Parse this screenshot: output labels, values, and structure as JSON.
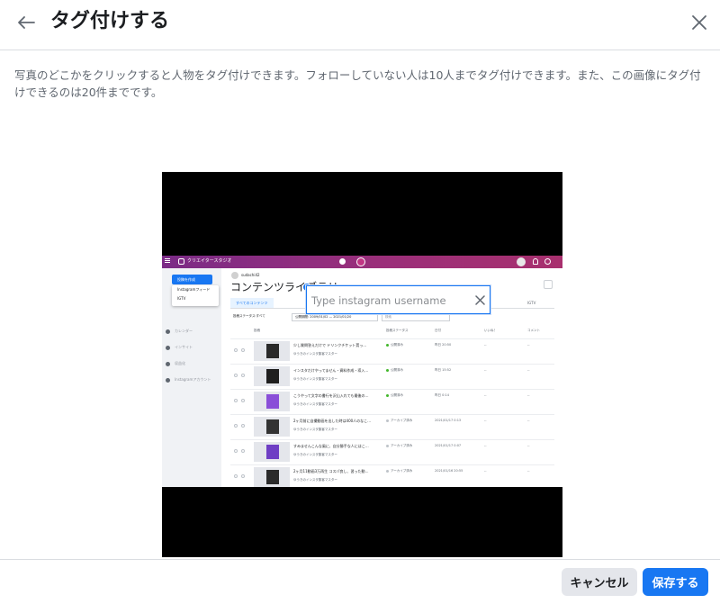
{
  "header": {
    "title": "タグ付けする",
    "back_icon": "arrow-left-icon",
    "close_icon": "close-icon"
  },
  "description": "写真のどこかをクリックすると人物をタグ付けできます。フォローしていない人は10人までタグ付けできます。また、この画像にタグ付けできるのは20件までです。",
  "tag_search": {
    "placeholder": "Type instagram username",
    "value": ""
  },
  "footer": {
    "cancel_label": "キャンセル",
    "save_label": "保存する"
  },
  "photo": {
    "topbar_title": "クリエイタースタジオ",
    "account": "sudachi42",
    "create_button": "投稿を作成",
    "dropdown_items": [
      "Instagramフィード",
      "IGTV"
    ],
    "sidebar_items": [
      "カレンダー",
      "インサイト",
      "収益化",
      "Instagramアカウント"
    ],
    "heading": "コンテンツライブラリ",
    "tabs": {
      "all": "すべてのコンテンツ",
      "igtv": "IGTV"
    },
    "filters": [
      "投稿ステータス:すべて",
      "公開期間: 2009/01/02 — 2021/01/20",
      "検索"
    ],
    "columns": [
      "投稿",
      "投稿ステータス",
      "日付",
      "いいね！",
      "コメント"
    ],
    "rows": [
      {
        "title": "少し質問答えだけで ドリンクチケット貰っ…",
        "account": "ゆうきのインスタ集客マスター",
        "status": "公開済み",
        "date": "昨日 20:50",
        "likes": "--",
        "comments": "--",
        "status_color": "#42b72a",
        "thumb_color": "#2a2a2a"
      },
      {
        "title": "インスタだけやってません・資料作成・導入…",
        "account": "ゆうきのインスタ集客マスター",
        "status": "公開済み",
        "date": "昨日 15:52",
        "likes": "--",
        "comments": "--",
        "status_color": "#42b72a",
        "thumb_color": "#1f1f1f"
      },
      {
        "title": "こうやって文字の書行を沢山入れても最後の…",
        "account": "ゆうきのインスタ集客マスター",
        "status": "公開済み",
        "date": "昨日 0:14",
        "likes": "--",
        "comments": "--",
        "status_color": "#42b72a",
        "thumb_color": "#8a4fd8"
      },
      {
        "title": "2ヶ月前に自撮動画を出した時は400人のなこ…",
        "account": "ゆうきのインスタ集客マスター",
        "status": "アーカイブ済み",
        "date": "2021/01/17 0:13",
        "likes": "--",
        "comments": "--",
        "status_color": "#bec3c9",
        "thumb_color": "#333333"
      },
      {
        "title": "すみませんこんな風に、自分勝手な人にはこ…",
        "account": "ゆうきのインスタ集客マスター",
        "status": "アーカイブ済み",
        "date": "2021/01/17 0:07",
        "likes": "--",
        "comments": "--",
        "status_color": "#bec3c9",
        "thumb_color": "#6f3fc4"
      },
      {
        "title": "2ヶ月11動画3万再生 コスパ良し、習った動…",
        "account": "ゆうきのインスタ集客マスター",
        "status": "アーカイブ済み",
        "date": "2021/01/16 20:55",
        "likes": "--",
        "comments": "--",
        "status_color": "#bec3c9",
        "thumb_color": "#2b2b2b"
      }
    ]
  },
  "colors": {
    "accent": "#1877f2",
    "cancel_bg": "#e4e6eb"
  }
}
